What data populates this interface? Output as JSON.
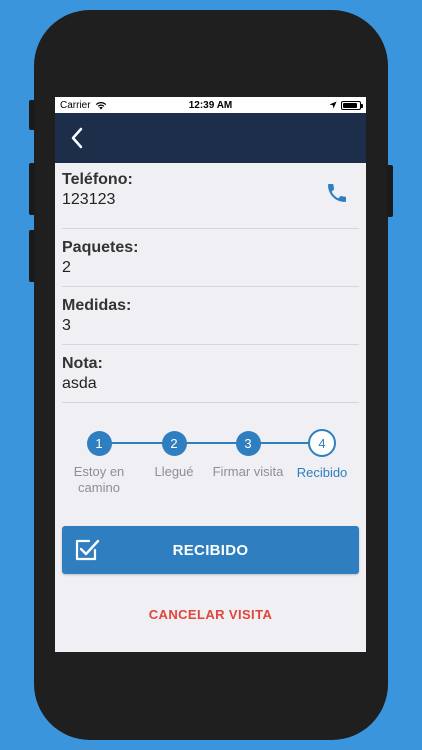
{
  "status_bar": {
    "carrier": "Carrier",
    "time": "12:39 AM",
    "battery_level": 0.9
  },
  "navbar": {
    "back_icon": "chevron-left-icon"
  },
  "fields": [
    {
      "label": "Teléfono:",
      "value": "123123",
      "icon": "phone-icon"
    },
    {
      "label": "Paquetes:",
      "value": "2"
    },
    {
      "label": "Medidas:",
      "value": "3"
    },
    {
      "label": "Nota:",
      "value": "asda"
    }
  ],
  "steps": [
    {
      "number": "1",
      "label": "Estoy en camino",
      "state": "done"
    },
    {
      "number": "2",
      "label": "Llegué",
      "state": "done"
    },
    {
      "number": "3",
      "label": "Firmar visita",
      "state": "done"
    },
    {
      "number": "4",
      "label": "Recibido",
      "state": "active"
    }
  ],
  "primary_button": {
    "label": "RECIBIDO",
    "icon": "checkbox-icon"
  },
  "cancel_button": {
    "label": "CANCELAR VISITA"
  },
  "colors": {
    "background": "#3a95dc",
    "navbar": "#1c2e4a",
    "accent": "#2f7fc0",
    "danger": "#e0463a",
    "screen_bg": "#efeff4"
  }
}
